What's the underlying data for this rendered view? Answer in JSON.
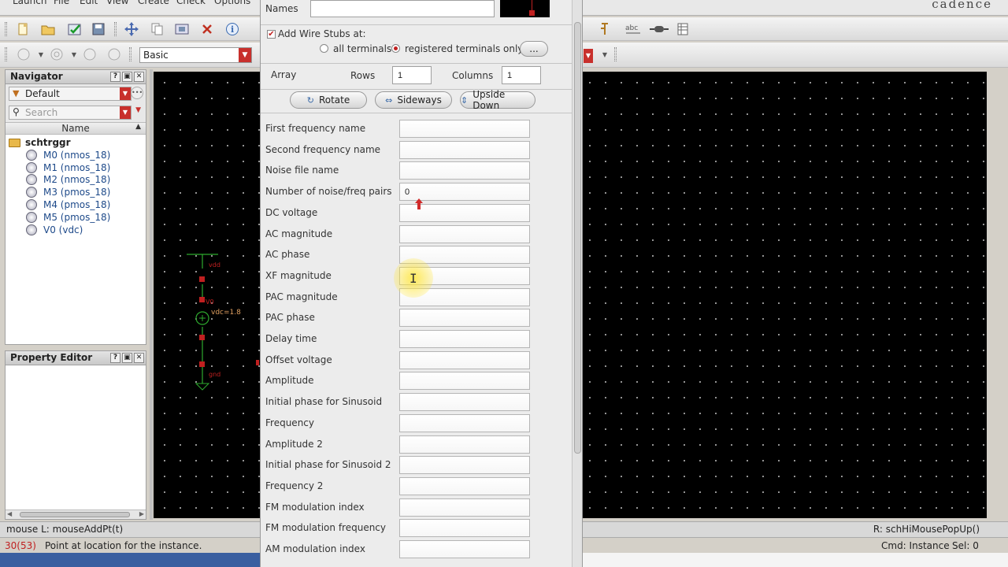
{
  "app": {
    "menu": [
      "Launch",
      "File",
      "Edit",
      "View",
      "Create",
      "Check",
      "Options"
    ],
    "brand": "cadence"
  },
  "toolbar": {
    "view_combo": "Basic"
  },
  "navigator": {
    "title": "Navigator",
    "filter_value": "Default",
    "search_placeholder": "Search",
    "column_name": "Name",
    "root": "schtrggr",
    "items": [
      "M0 (nmos_18)",
      "M1 (nmos_18)",
      "M2 (nmos_18)",
      "M3 (pmos_18)",
      "M4 (pmos_18)",
      "M5 (pmos_18)",
      "V0 (vdc)"
    ]
  },
  "property_editor": {
    "title": "Property Editor"
  },
  "schematic": {
    "labels": {
      "vdd": "vdd",
      "v0": "V0",
      "vdc": "vdc=1.8",
      "gnd": "gnd"
    }
  },
  "dialog": {
    "names_label": "Names",
    "names_value": "",
    "wire_stubs_label": "Add Wire Stubs at:",
    "wire_stubs_checked": true,
    "radio_all": "all terminals",
    "radio_registered": "registered terminals only",
    "more_button": "...",
    "array_label": "Array",
    "rows_label": "Rows",
    "rows_value": "1",
    "columns_label": "Columns",
    "columns_value": "1",
    "rotate": "Rotate",
    "sideways": "Sideways",
    "upside_down": "Upside Down",
    "properties": [
      {
        "label": "First frequency name",
        "value": ""
      },
      {
        "label": "Second frequency name",
        "value": ""
      },
      {
        "label": "Noise file name",
        "value": ""
      },
      {
        "label": "Number of noise/freq pairs",
        "value": "0"
      },
      {
        "label": "DC voltage",
        "value": ""
      },
      {
        "label": "AC magnitude",
        "value": ""
      },
      {
        "label": "AC phase",
        "value": ""
      },
      {
        "label": "XF magnitude",
        "value": ""
      },
      {
        "label": "PAC magnitude",
        "value": ""
      },
      {
        "label": "PAC phase",
        "value": ""
      },
      {
        "label": "Delay time",
        "value": ""
      },
      {
        "label": "Offset voltage",
        "value": ""
      },
      {
        "label": "Amplitude",
        "value": ""
      },
      {
        "label": "Initial phase for Sinusoid",
        "value": ""
      },
      {
        "label": "Frequency",
        "value": ""
      },
      {
        "label": "Amplitude 2",
        "value": ""
      },
      {
        "label": "Initial phase for Sinusoid 2",
        "value": ""
      },
      {
        "label": "Frequency 2",
        "value": ""
      },
      {
        "label": "FM modulation index",
        "value": ""
      },
      {
        "label": "FM modulation frequency",
        "value": ""
      },
      {
        "label": "AM modulation index",
        "value": ""
      }
    ]
  },
  "status": {
    "mouse_left": "mouse L: mouseAddPt(t)",
    "mouse_right": "R: schHiMousePopUp()",
    "counter": "30(53)",
    "prompt": "Point at location for the instance.",
    "cmd": "Cmd: Instance",
    "sel": "Sel: 0"
  },
  "colors": {
    "accent_red": "#c8302c",
    "canvas_bg": "#000000",
    "wire": "#c02020"
  }
}
